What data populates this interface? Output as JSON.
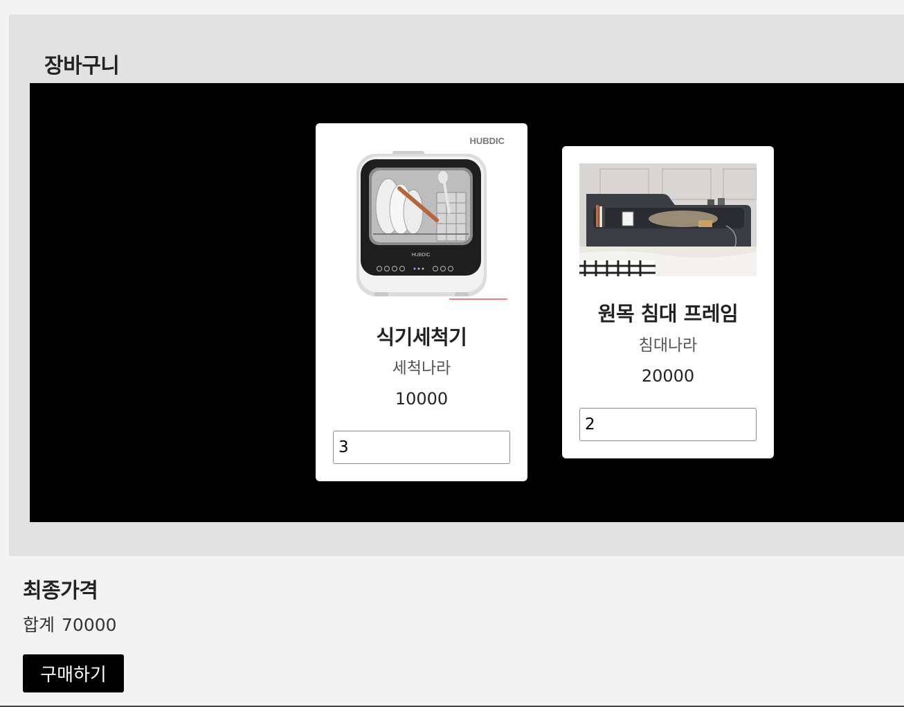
{
  "cart": {
    "title": "장바구니",
    "items": [
      {
        "name": "식기세척기",
        "seller": "세척나라",
        "price": "10000",
        "quantity": "3",
        "image_brand_text": "HUBDIC",
        "image_icon": "dishwasher-image"
      },
      {
        "name": "원목 침대 프레임",
        "seller": "침대나라",
        "price": "20000",
        "quantity": "2",
        "image_icon": "bed-frame-image"
      }
    ]
  },
  "summary": {
    "title": "최종가격",
    "total_label": "합계",
    "total_value": "70000"
  },
  "actions": {
    "buy_label": "구매하기"
  },
  "colors": {
    "page_background": "#f3f3f3",
    "section_background": "#e2e2e2",
    "stage_background": "#000000",
    "card_background": "#ffffff",
    "button_background": "#000000",
    "button_text": "#ffffff"
  }
}
